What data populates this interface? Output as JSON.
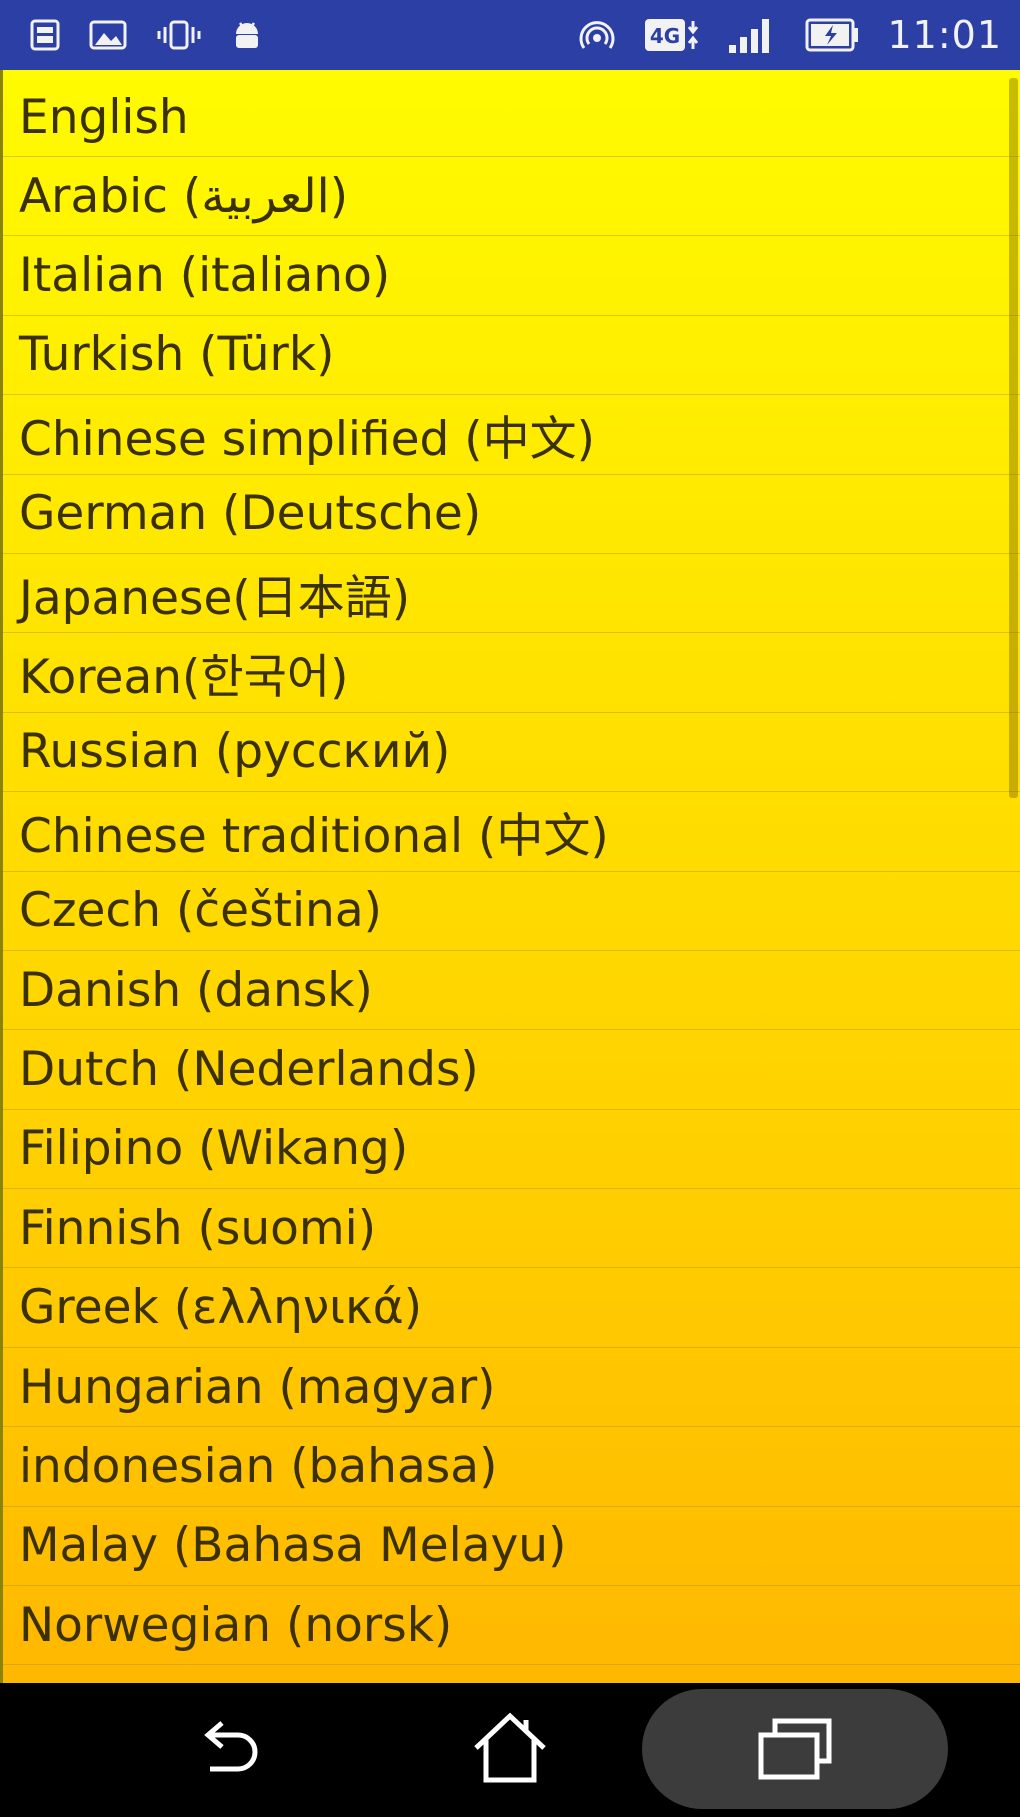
{
  "status_bar": {
    "time": "11:01",
    "network_badge": "4G",
    "left_icons": [
      "sim-card-icon",
      "image-icon",
      "vibrate-icon",
      "android-icon"
    ],
    "right_icons": [
      "hotspot-icon",
      "network-4g-icon",
      "signal-icon",
      "battery-icon"
    ]
  },
  "languages": [
    "English",
    "Arabic (العربية)",
    "Italian (italiano)",
    "Turkish (Türk)",
    "Chinese simplified (中文)",
    "German (Deutsche)",
    "Japanese(日本語)",
    "Korean(한국어)",
    "Russian (русский)",
    "Chinese traditional (中文)",
    "Czech (čeština)",
    "Danish (dansk)",
    "Dutch (Nederlands)",
    "Filipino (Wikang)",
    "Finnish (suomi)",
    "Greek (ελληνικά)",
    "Hungarian (magyar)",
    "indonesian (bahasa)",
    "Malay (Bahasa Melayu)",
    "Norwegian (norsk)"
  ],
  "nav_bar": {
    "buttons": [
      "back-icon",
      "home-icon",
      "recents-icon"
    ]
  }
}
